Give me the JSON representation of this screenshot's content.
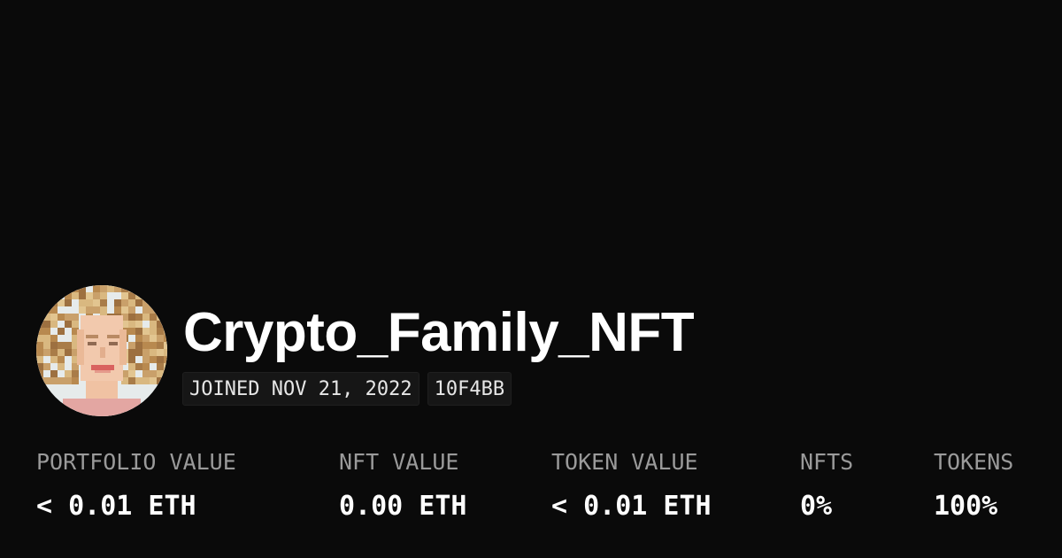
{
  "profile": {
    "username": "Crypto_Family_NFT",
    "joined": "JOINED NOV 21, 2022",
    "address_short": "10F4BB",
    "avatar_icon": "pixel-portrait-avatar"
  },
  "stats": [
    {
      "label": "PORTFOLIO VALUE",
      "value": "< 0.01 ETH"
    },
    {
      "label": "NFT VALUE",
      "value": "0.00 ETH"
    },
    {
      "label": "TOKEN VALUE",
      "value": "< 0.01 ETH"
    },
    {
      "label": "NFTS",
      "value": "0%"
    },
    {
      "label": "TOKENS",
      "value": "100%"
    }
  ],
  "colors": {
    "background": "#0a0a0a",
    "text_primary": "#ffffff",
    "text_muted": "#9a9a9a",
    "badge_bg": "#161616"
  }
}
